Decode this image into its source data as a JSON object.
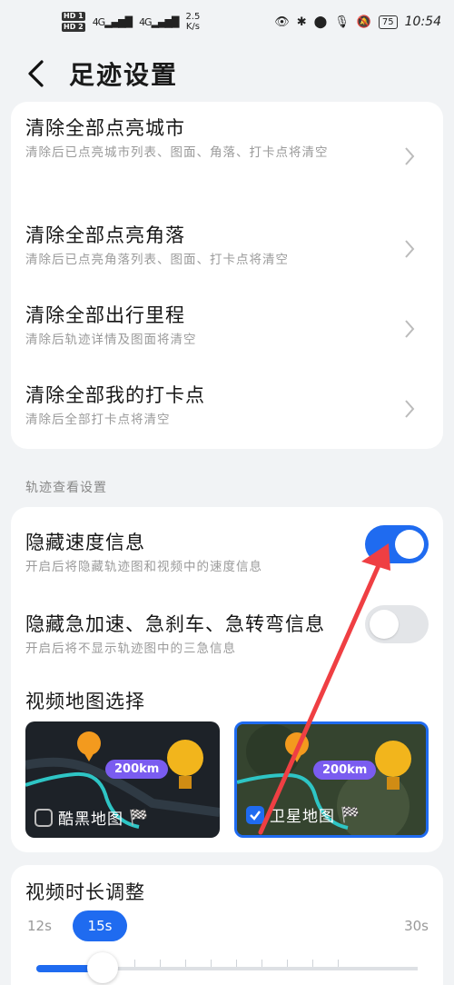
{
  "status_bar": {
    "hd1": "HD 1",
    "hd2": "HD 2",
    "signal1": "4G",
    "signal2": "4G",
    "speed_value": "2.5",
    "speed_unit": "K/s",
    "battery": "75",
    "time": "10:54"
  },
  "header": {
    "title": "足迹设置"
  },
  "clear_section": {
    "items": [
      {
        "title": "清除全部点亮城市",
        "desc": "清除后已点亮城市列表、图面、角落、打卡点将清空"
      },
      {
        "title": "清除全部点亮角落",
        "desc": "清除后已点亮角落列表、图面、打卡点将清空"
      },
      {
        "title": "清除全部出行里程",
        "desc": "清除后轨迹详情及图面将清空"
      },
      {
        "title": "清除全部我的打卡点",
        "desc": "清除后全部打卡点将清空"
      }
    ]
  },
  "view_settings": {
    "section_label": "轨迹查看设置",
    "hide_speed": {
      "title": "隐藏速度信息",
      "desc": "开启后将隐藏轨迹图和视频中的速度信息",
      "on": true
    },
    "hide_harsh": {
      "title": "隐藏急加速、急刹车、急转弯信息",
      "desc": "开启后将不显示轨迹图中的三急信息",
      "on": false
    },
    "map_select": {
      "title": "视频地图选择",
      "options": [
        {
          "label": "酷黑地图",
          "badge": "200km",
          "selected": false
        },
        {
          "label": "卫星地图",
          "badge": "200km",
          "selected": true
        }
      ]
    }
  },
  "duration": {
    "title": "视频时长调整",
    "min_label": "12s",
    "max_label": "30s",
    "current_label": "15s",
    "current_value": 15,
    "min": 12,
    "max": 30
  },
  "colors": {
    "accent": "#1f6bf0",
    "annotation_arrow": "#ef3f43"
  }
}
